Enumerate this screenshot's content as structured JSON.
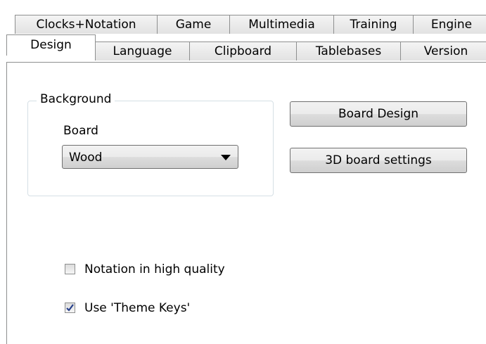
{
  "tabs_row_top": [
    "Clocks+Notation",
    "Game",
    "Multimedia",
    "Training",
    "Engine"
  ],
  "tabs_row_bottom": [
    "Design",
    "Language",
    "Clipboard",
    "Tablebases",
    "Version"
  ],
  "active_tab": "Design",
  "background_group": {
    "title": "Background",
    "board_label": "Board",
    "board_select_value": "Wood"
  },
  "buttons": {
    "board_design": "Board Design",
    "board_3d_settings": "3D board settings"
  },
  "checkboxes": [
    {
      "label": "Notation in high quality",
      "checked": false
    },
    {
      "label": "Use 'Theme Keys'",
      "checked": true
    }
  ],
  "icons": {
    "dropdown": "triangle-down-icon",
    "check": "checkmark-icon"
  }
}
